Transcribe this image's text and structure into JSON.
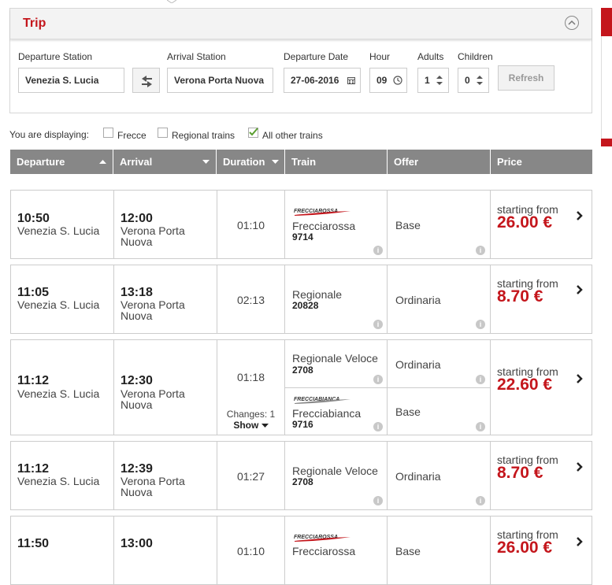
{
  "trip": {
    "title": "Trip",
    "departure_label": "Departure Station",
    "departure_value": "Venezia S. Lucia",
    "arrival_label": "Arrival Station",
    "arrival_value": "Verona Porta Nuova",
    "date_label": "Departure Date",
    "date_value": "27-06-2016",
    "hour_label": "Hour",
    "hour_value": "09",
    "adults_label": "Adults",
    "adults_value": "1",
    "children_label": "Children",
    "children_value": "0",
    "refresh_label": "Refresh"
  },
  "filters": {
    "prefix": "You are displaying:",
    "frecce": "Frecce",
    "frecce_checked": false,
    "regional": "Regional trains",
    "regional_checked": false,
    "other": "All other trains",
    "other_checked": true
  },
  "table": {
    "headers": {
      "departure": "Departure",
      "arrival": "Arrival",
      "duration": "Duration",
      "train": "Train",
      "offer": "Offer",
      "price": "Price"
    }
  },
  "rows": [
    {
      "dep_time": "10:50",
      "dep_station": "Venezia S. Lucia",
      "arr_time": "12:00",
      "arr_station_1": "Verona Porta",
      "arr_station_2": "Nuova",
      "duration": "01:10",
      "train_logo": "FRECCIAROSSA",
      "train_name": "Frecciarossa",
      "train_number": "9714",
      "offer": "Base",
      "starting": "starting from",
      "price": "26.00 €"
    },
    {
      "dep_time": "11:05",
      "dep_station": "Venezia S. Lucia",
      "arr_time": "13:18",
      "arr_station_1": "Verona Porta",
      "arr_station_2": "Nuova",
      "duration": "02:13",
      "train_name": "Regionale",
      "train_number": "20828",
      "offer": "Ordinaria",
      "starting": "starting from",
      "price": "8.70 €"
    },
    {
      "dep_time": "11:12",
      "dep_station": "Venezia S. Lucia",
      "arr_time": "12:30",
      "arr_station_1": "Verona Porta",
      "arr_station_2": "Nuova",
      "duration": "01:18",
      "changes": "Changes: 1",
      "show": "Show",
      "train_name": "Regionale Veloce",
      "train_number": "2708",
      "offer": "Ordinaria",
      "train2_logo": "FRECCIABIANCA",
      "train2_name": "Frecciabianca",
      "train2_number": "9716",
      "offer2": "Base",
      "starting": "starting from",
      "price": "22.60 €"
    },
    {
      "dep_time": "11:12",
      "dep_station": "Venezia S. Lucia",
      "arr_time": "12:39",
      "arr_station_1": "Verona Porta",
      "arr_station_2": "Nuova",
      "duration": "01:27",
      "train_name": "Regionale Veloce",
      "train_number": "2708",
      "offer": "Ordinaria",
      "starting": "starting from",
      "price": "8.70 €"
    },
    {
      "dep_time": "11:50",
      "arr_time": "13:00",
      "duration": "01:10",
      "train_logo": "FRECCIAROSSA",
      "train_name": "Frecciarossa",
      "offer": "Base",
      "starting": "starting from",
      "price": "26.00 €"
    }
  ],
  "colors": {
    "accent": "#c4161c",
    "header_bg": "#878787"
  },
  "icons": [
    "chevron-up-icon",
    "swap-arrows-icon",
    "calendar-icon",
    "clock-icon",
    "spinner-icon",
    "sort-asc-icon",
    "sort-desc-icon",
    "info-icon",
    "chevron-right-icon",
    "checkmark-icon"
  ]
}
